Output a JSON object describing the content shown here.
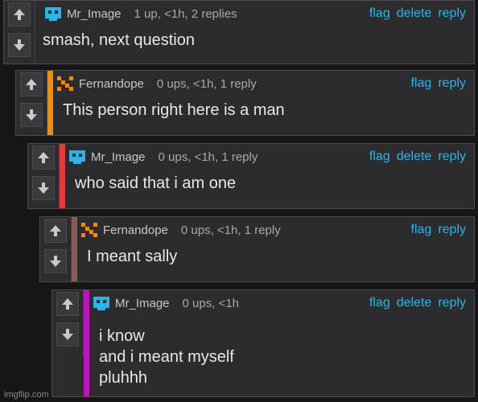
{
  "colors": {
    "link": "#29b6e6",
    "stripe_orange": "#ff8800",
    "stripe_red": "#e53935",
    "stripe_dim": "#8d5a55",
    "stripe_magenta": "#c013c0"
  },
  "icons": {
    "up": "arrow-up-icon",
    "down": "arrow-down-icon"
  },
  "comments": [
    {
      "user": "Mr_Image",
      "meta": "1 up, <1h, 2 replies",
      "actions": [
        "flag",
        "delete",
        "reply"
      ],
      "body": "smash, next question"
    },
    {
      "user": "Fernandope",
      "meta": "0 ups, <1h, 1 reply",
      "actions": [
        "flag",
        "reply"
      ],
      "body": "This person right here is a man"
    },
    {
      "user": "Mr_Image",
      "meta": "0 ups, <1h, 1 reply",
      "actions": [
        "flag",
        "delete",
        "reply"
      ],
      "body": "who said that i am one"
    },
    {
      "user": "Fernandope",
      "meta": "0 ups, <1h, 1 reply",
      "actions": [
        "flag",
        "reply"
      ],
      "body": "I meant sally"
    },
    {
      "user": "Mr_Image",
      "meta": "0 ups, <1h",
      "actions": [
        "flag",
        "delete",
        "reply"
      ],
      "body": "i know\nand i meant myself\npluhhh"
    }
  ],
  "watermark": "imgflip.com"
}
